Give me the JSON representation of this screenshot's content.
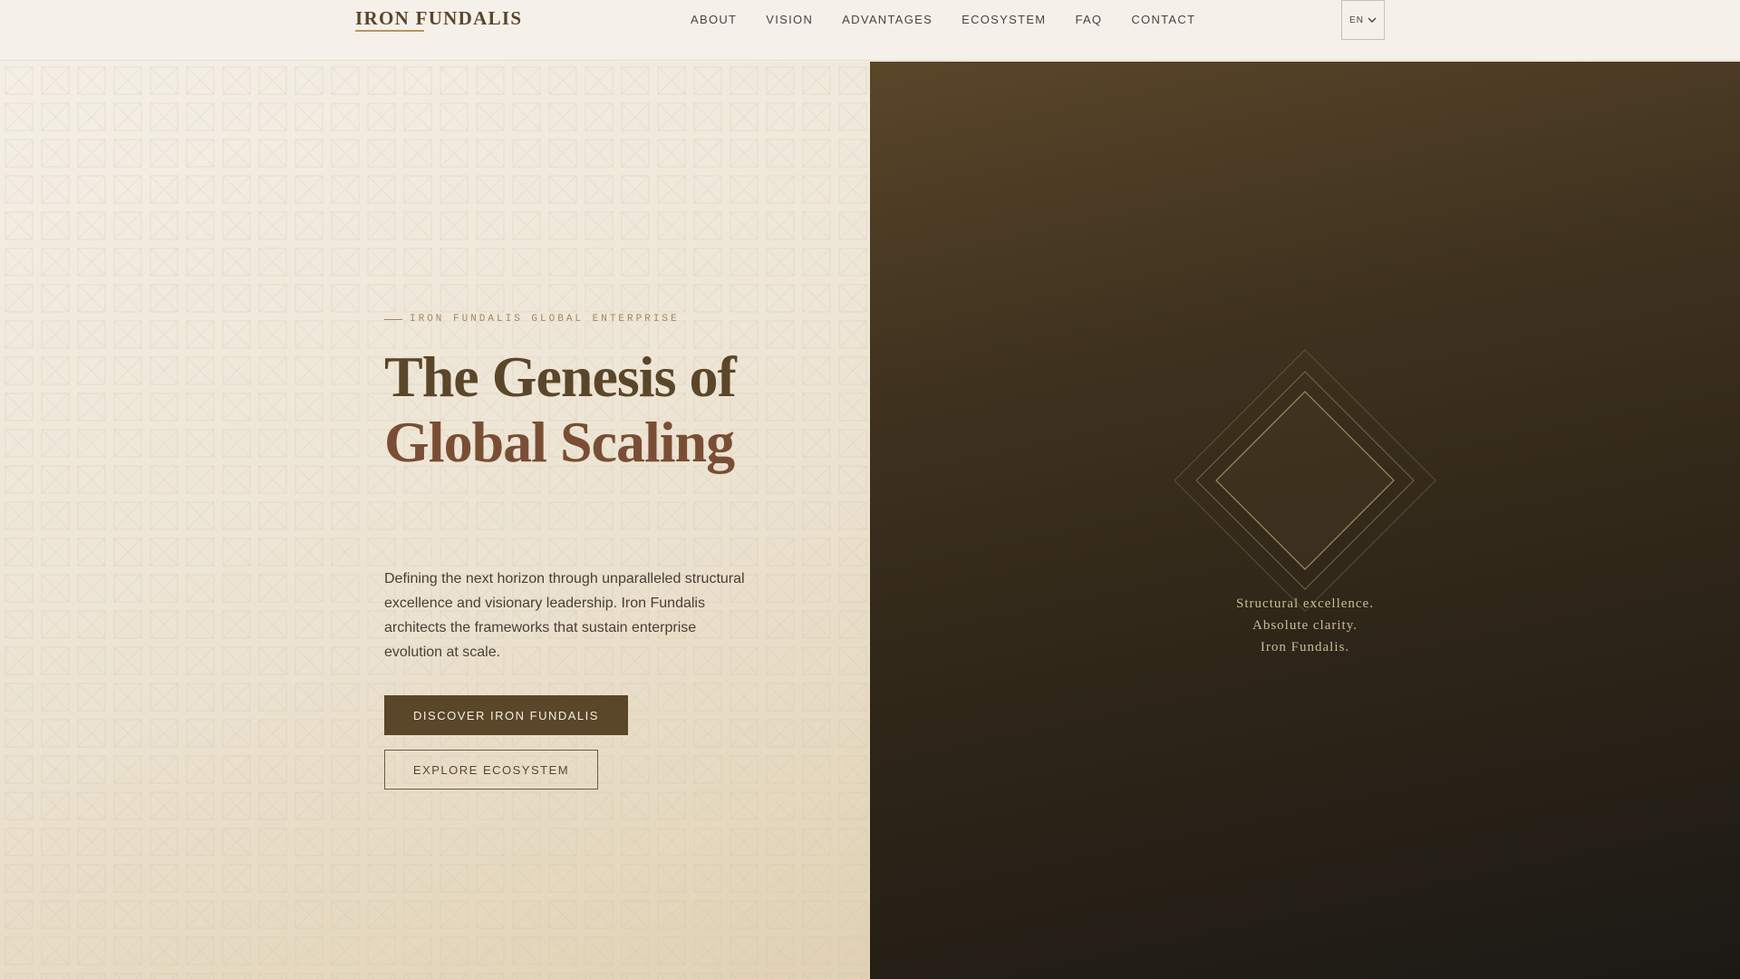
{
  "header": {
    "logo": "IRON FUNDALIS",
    "nav": [
      "ABOUT",
      "VISION",
      "ADVANTAGES",
      "ECOSYSTEM",
      "FAQ",
      "CONTACT"
    ],
    "language": "EN"
  },
  "hero": {
    "eyebrow": "IRON FUNDALIS GLOBAL ENTERPRISE",
    "headline_line1": "The Genesis of",
    "headline_line2": "Global Scaling",
    "description": "Defining the next horizon through unparalleled structural excellence and visionary leadership. Iron Fundalis architects the frameworks that sustain enterprise evolution at scale.",
    "primary_cta": "DISCOVER IRON FUNDALIS",
    "secondary_cta": "EXPLORE ECOSYSTEM"
  },
  "visual": {
    "tagline": [
      "Structural excellence.",
      "Absolute clarity.",
      "Iron Fundalis."
    ]
  },
  "colors": {
    "brand_dark": "#5a4628",
    "accent_rust": "#7a4e34",
    "accent_gold": "#b8965c",
    "panel_dark": "#2f2618"
  }
}
